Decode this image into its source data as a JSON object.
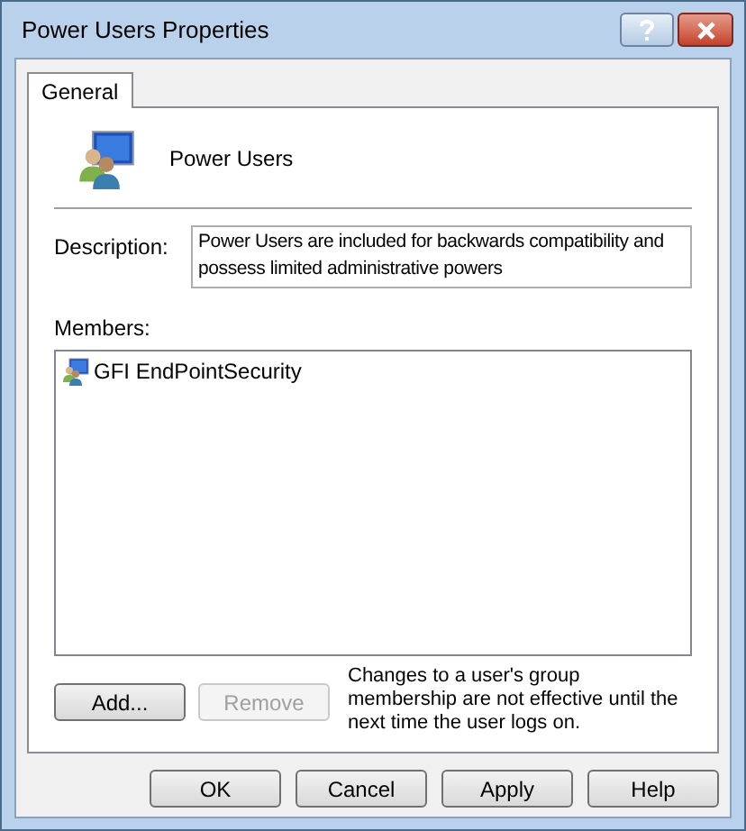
{
  "window": {
    "title": "Power Users Properties"
  },
  "tabs": [
    {
      "label": "General",
      "selected": true
    }
  ],
  "group": {
    "name": "Power Users"
  },
  "description": {
    "label": "Description:",
    "value": "Power Users are included for backwards compatibility and possess limited administrative powers"
  },
  "members": {
    "label": "Members:",
    "items": [
      {
        "name": "GFI EndPointSecurity"
      }
    ]
  },
  "member_buttons": [
    {
      "label": "Add...",
      "disabled": false
    },
    {
      "label": "Remove",
      "disabled": true
    }
  ],
  "note": "Changes to a user's group membership are not effective until the next time the user logs on.",
  "buttons": [
    {
      "label": "OK",
      "disabled": false
    },
    {
      "label": "Cancel",
      "disabled": false
    },
    {
      "label": "Apply",
      "disabled": false
    },
    {
      "label": "Help",
      "disabled": false
    }
  ]
}
